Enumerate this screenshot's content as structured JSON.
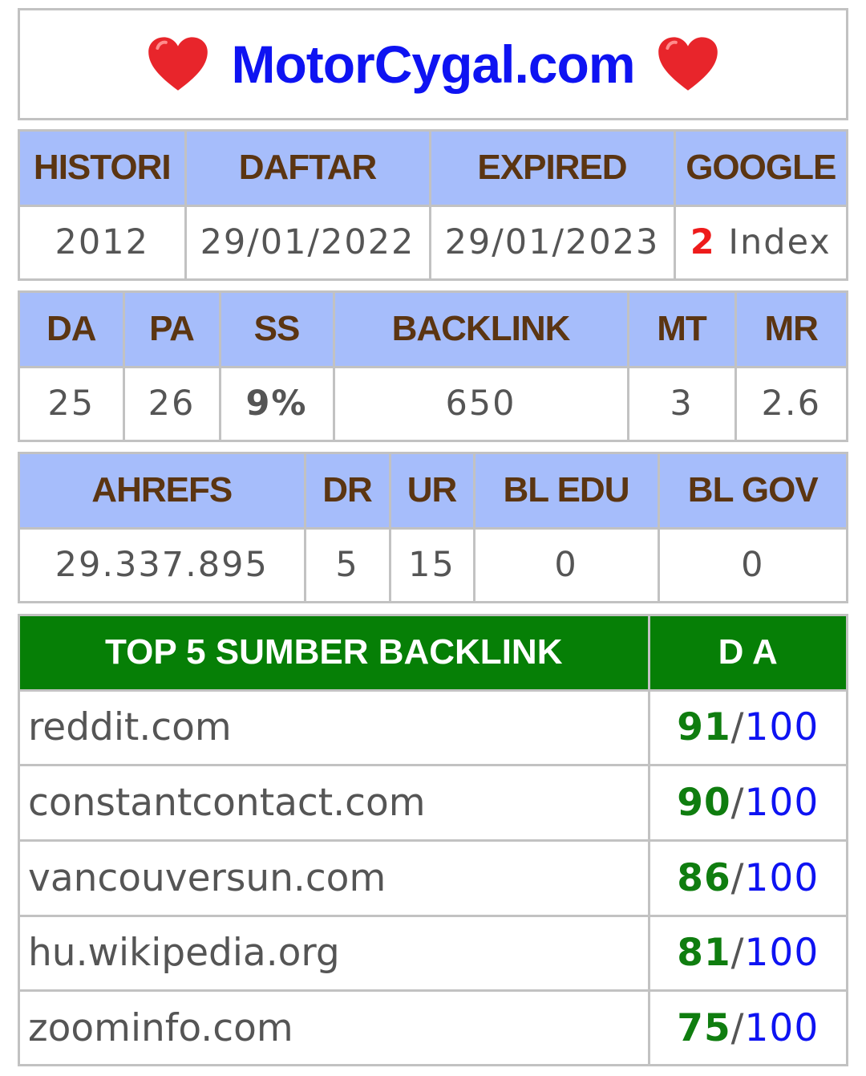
{
  "title": "MotorCygal.com",
  "title_icon": "heart-icon",
  "colors": {
    "title": "#0e13f2",
    "header_bg": "#a6bdfb",
    "header_text": "#5b3512",
    "top_header_bg": "#067f06",
    "green_value": "#0f7d0f",
    "red_value": "#ee1b1b",
    "heart": "#e8252b"
  },
  "table1": {
    "headers": [
      "HISTORI",
      "DAFTAR",
      "EXPIRED",
      "GOOGLE"
    ],
    "histori": "2012",
    "daftar": "29/01/2022",
    "expired": "29/01/2023",
    "google_count": "2",
    "google_label": "Index"
  },
  "table2": {
    "headers": [
      "DA",
      "PA",
      "SS",
      "BACKLINK",
      "MT",
      "MR"
    ],
    "values": [
      "25",
      "26",
      "9%",
      "650",
      "3",
      "2.6"
    ]
  },
  "table3": {
    "headers": [
      "AHREFS",
      "DR",
      "UR",
      "BL EDU",
      "BL GOV"
    ],
    "values": [
      "29.337.895",
      "5",
      "15",
      "0",
      "0"
    ]
  },
  "top_backlinks": {
    "header_source": "TOP 5 SUMBER BACKLINK",
    "header_da": "D A",
    "separator": "/",
    "max": "100",
    "rows": [
      {
        "site": "reddit.com",
        "da": "91"
      },
      {
        "site": "constantcontact.com",
        "da": "90"
      },
      {
        "site": "vancouversun.com",
        "da": "86"
      },
      {
        "site": "hu.wikipedia.org",
        "da": "81"
      },
      {
        "site": "zoominfo.com",
        "da": "75"
      }
    ]
  }
}
